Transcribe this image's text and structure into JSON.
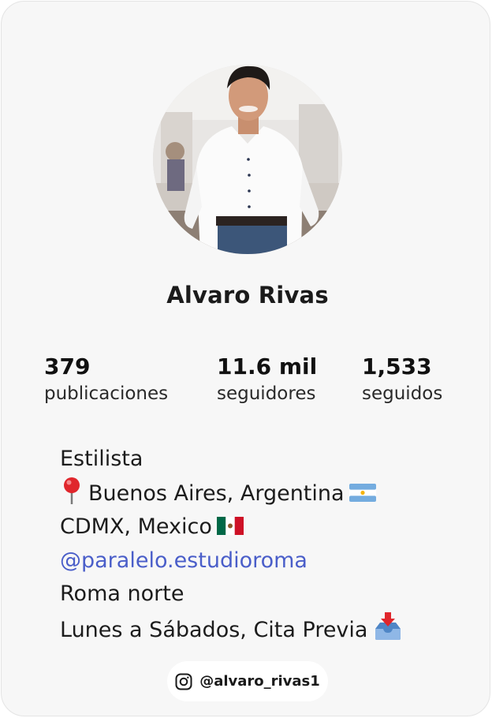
{
  "profile": {
    "name": "Alvaro Rivas",
    "handle": "@alvaro_rivas1"
  },
  "stats": [
    {
      "value": "379",
      "label": "publicaciones"
    },
    {
      "value": "11.6 mil",
      "label": "seguidores"
    },
    {
      "value": "1,533",
      "label": "seguidos"
    }
  ],
  "bio": {
    "line1": "Estilista",
    "line2": "Buenos Aires, Argentina",
    "line3": "CDMX, Mexico",
    "line4_link": "@paralelo.estudioroma",
    "line5": "Roma norte",
    "line6": "Lunes a Sábados, Cita Previa"
  },
  "icons": {
    "pin": "round-pushpin-icon",
    "argentina_flag": "argentina-flag-icon",
    "mexico_flag": "mexico-flag-icon",
    "inbox": "inbox-tray-icon",
    "instagram": "instagram-icon"
  },
  "colors": {
    "card_background": "#f7f7f7",
    "link": "#4a5ec9",
    "text": "#1c1c1c"
  }
}
